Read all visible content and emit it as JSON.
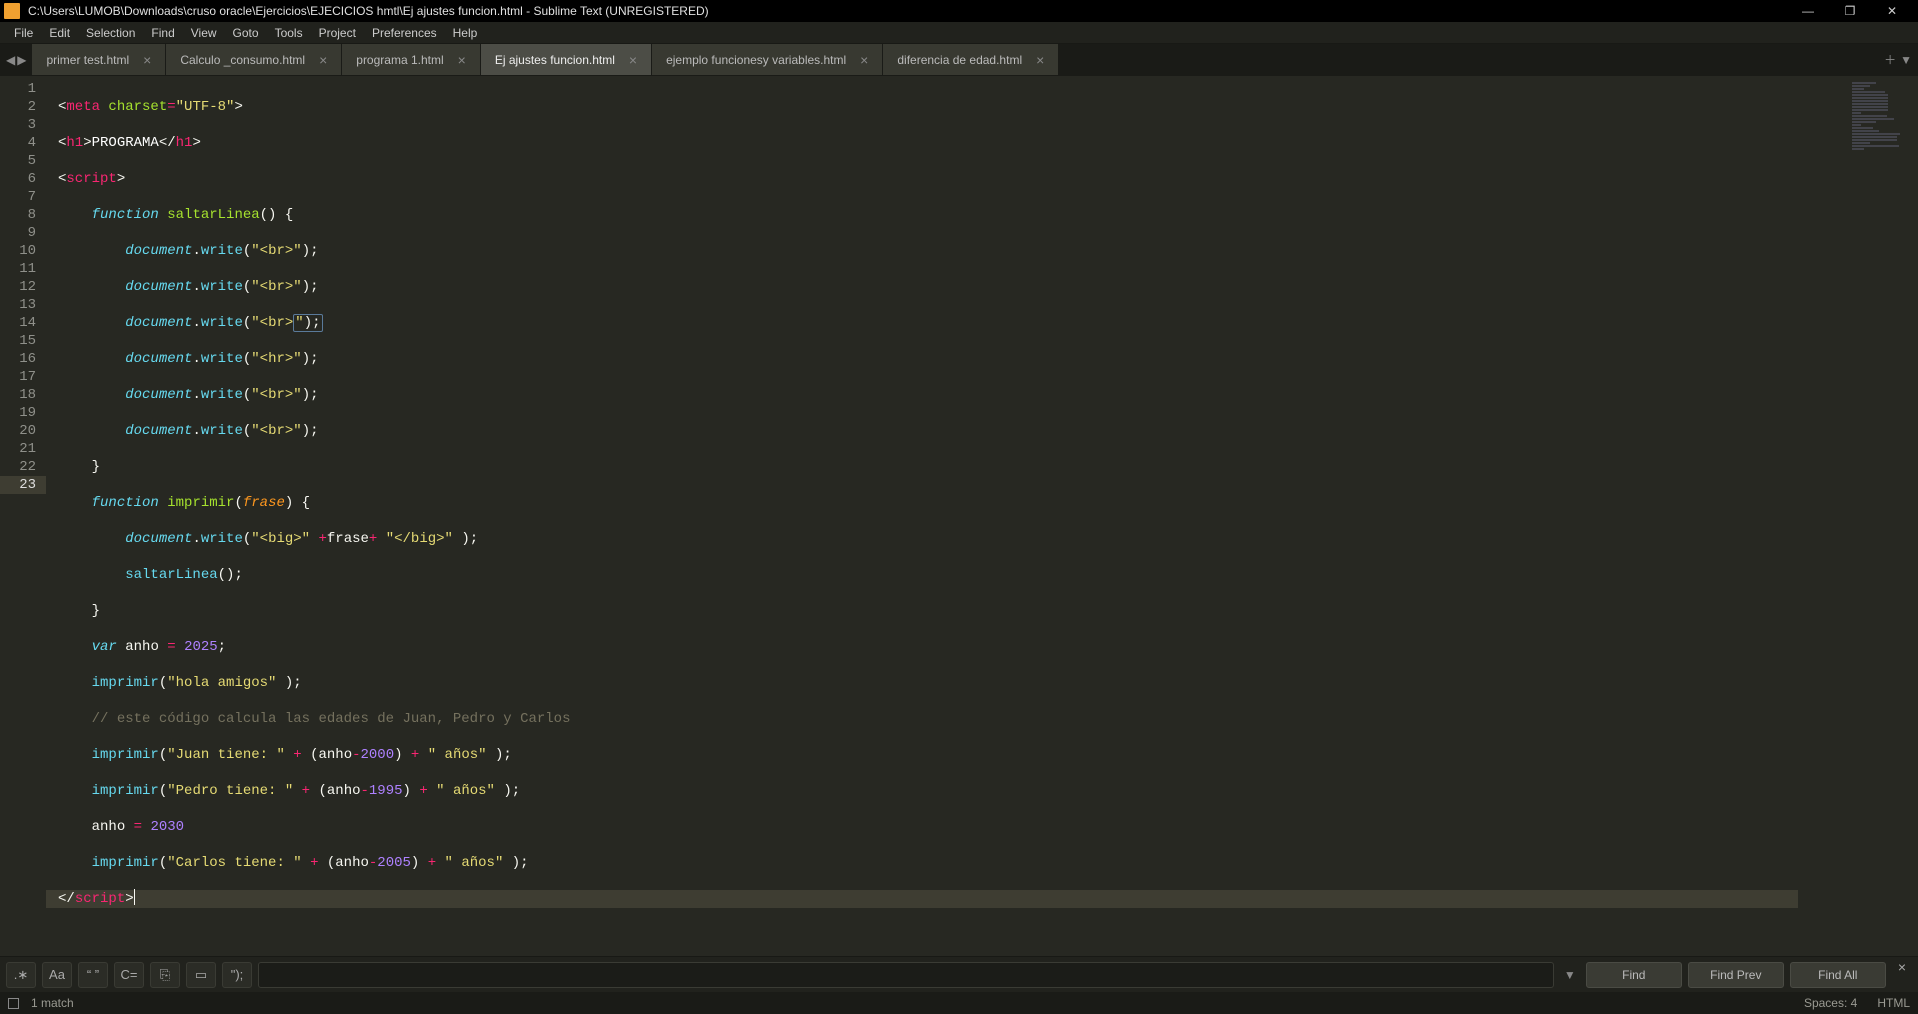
{
  "window": {
    "title": "C:\\Users\\LUMOB\\Downloads\\cruso oracle\\Ejercicios\\EJECICIOS hmtl\\Ej ajustes funcion.html - Sublime Text (UNREGISTERED)"
  },
  "menu": [
    "File",
    "Edit",
    "Selection",
    "Find",
    "View",
    "Goto",
    "Tools",
    "Project",
    "Preferences",
    "Help"
  ],
  "tabs": [
    {
      "label": "primer test.html",
      "active": false
    },
    {
      "label": "Calculo _consumo.html",
      "active": false
    },
    {
      "label": "programa 1.html",
      "active": false
    },
    {
      "label": "Ej ajustes funcion.html",
      "active": true
    },
    {
      "label": "ejemplo funcionesy variables.html",
      "active": false
    },
    {
      "label": "diferencia de edad.html",
      "active": false
    }
  ],
  "code": {
    "lines": 23,
    "l1": {
      "tag": "meta",
      "attr": "charset",
      "op": "=",
      "val": "\"UTF-8\""
    },
    "l2": {
      "open": "h1",
      "text": "PROGRAMA"
    },
    "l3": {
      "open": "script"
    },
    "l4": {
      "kw": "function",
      "name": "saltarLinea"
    },
    "l5": {
      "obj": "document",
      "m": "write",
      "arg": "\"<br>\""
    },
    "l6": {
      "obj": "document",
      "m": "write",
      "arg": "\"<br>\""
    },
    "l7": {
      "obj": "document",
      "m": "write",
      "arg1": "\"<br>",
      "arg2": "\");"
    },
    "l8": {
      "obj": "document",
      "m": "write",
      "arg": "\"<hr>\""
    },
    "l9": {
      "obj": "document",
      "m": "write",
      "arg": "\"<br>\""
    },
    "l10": {
      "obj": "document",
      "m": "write",
      "arg": "\"<br>\""
    },
    "l12": {
      "kw": "function",
      "name": "imprimir",
      "p": "frase"
    },
    "l13": {
      "obj": "document",
      "m": "write",
      "a1": "\"<big>\"",
      "op": "+",
      "v": "frase",
      "a2": "\"</big>\""
    },
    "l14": {
      "call": "saltarLinea"
    },
    "l16": {
      "kw": "var",
      "name": "anho",
      "op": "=",
      "val": "2025"
    },
    "l17": {
      "call": "imprimir",
      "arg": "\"hola amigos\""
    },
    "l18": {
      "cmt": "// este código calcula las edades de Juan, Pedro y Carlos"
    },
    "l19": {
      "call": "imprimir",
      "s1": "\"Juan tiene: \"",
      "v": "anho",
      "n": "2000",
      "s2": "\" años\""
    },
    "l20": {
      "call": "imprimir",
      "s1": "\"Pedro tiene: \"",
      "v": "anho",
      "n": "1995",
      "s2": "\" años\""
    },
    "l21": {
      "name": "anho",
      "op": "=",
      "val": "2030"
    },
    "l22": {
      "call": "imprimir",
      "s1": "\"Carlos tiene: \"",
      "v": "anho",
      "n": "2005",
      "s2": "\" años\""
    },
    "l23": {
      "close": "script"
    }
  },
  "find": {
    "opts": [
      ".∗",
      "Aa",
      "“ ”",
      "C=",
      "⎘",
      "▭",
      "\");"
    ],
    "btn_find": "Find",
    "btn_prev": "Find Prev",
    "btn_all": "Find All",
    "input": ""
  },
  "status": {
    "left": "1 match",
    "spaces": "Spaces: 4",
    "lang": "HTML"
  }
}
